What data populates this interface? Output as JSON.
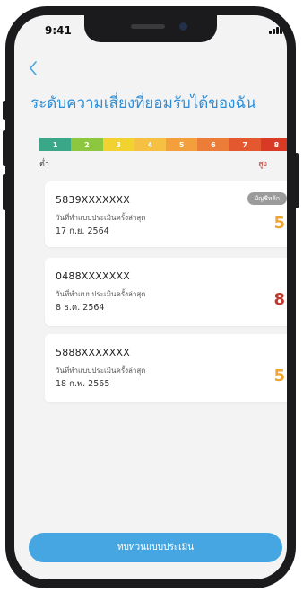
{
  "status_bar": {
    "time": "9:41"
  },
  "header": {
    "back_icon": "chevron-left-icon",
    "title": "ระดับความเสี่ยงที่ยอมรับได้ของฉัน"
  },
  "risk_scale": {
    "levels": [
      "1",
      "2",
      "3",
      "4",
      "5",
      "6",
      "7",
      "8"
    ],
    "colors": [
      "#3aa888",
      "#8dc63f",
      "#f2d230",
      "#f6c043",
      "#f29f3c",
      "#ec7d38",
      "#e4582f",
      "#d83a26"
    ],
    "low_label": "ต่ำ",
    "high_label": "สูง"
  },
  "assessments": [
    {
      "account": "5839XXXXXXX",
      "date_label": "วันที่ทำแบบประเมินครั้งล่าสุด",
      "date": "17 ก.ย. 2564",
      "score": "5",
      "score_color": "#f0a533",
      "badge": "บัญชีหลัก"
    },
    {
      "account": "0488XXXXXXX",
      "date_label": "วันที่ทำแบบประเมินครั้งล่าสุด",
      "date": "8 ธ.ค. 2564",
      "score": "8",
      "score_color": "#c0392b"
    },
    {
      "account": "5888XXXXXXX",
      "date_label": "วันที่ทำแบบประเมินครั้งล่าสุด",
      "date": "18 ก.พ. 2565",
      "score": "5",
      "score_color": "#f0a533"
    }
  ],
  "actions": {
    "review_label": "ทบทวนแบบประเมิน"
  }
}
